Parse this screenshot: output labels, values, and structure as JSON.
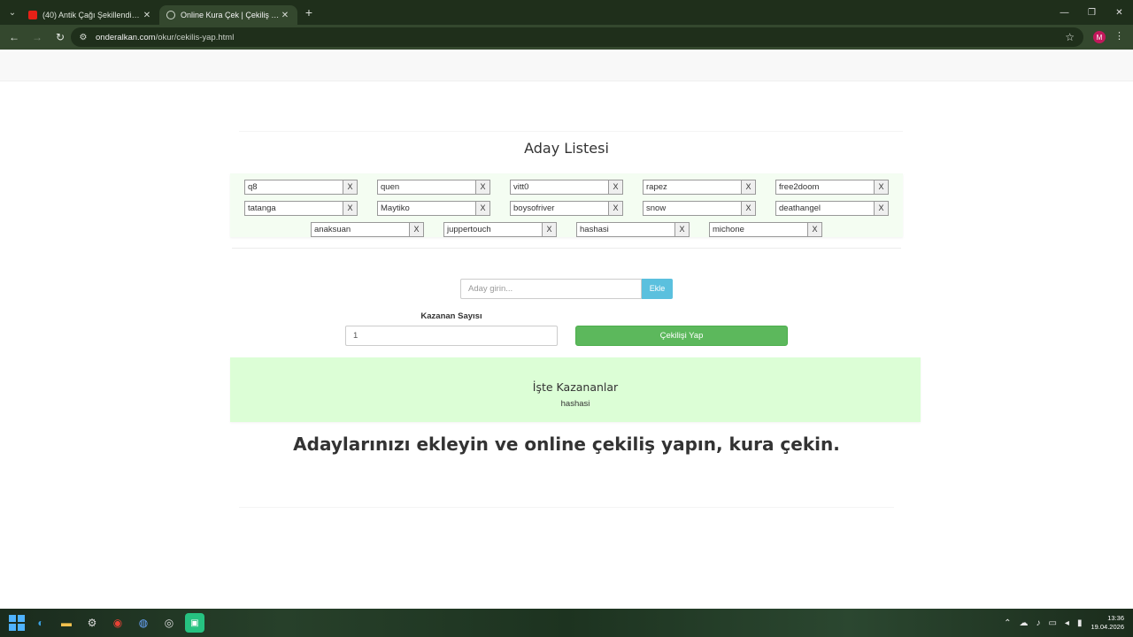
{
  "browser": {
    "tabs": [
      {
        "title": "(40) Antik Çağı Şekillendiren Bü",
        "favicon": "youtube-icon",
        "active": false
      },
      {
        "title": "Online Kura Çek | Çekiliş Yap",
        "favicon": "globe-icon",
        "active": true
      }
    ],
    "url_host": "onderalkan.com",
    "url_path": "/okur/cekilis-yap.html",
    "profile_initial": "M"
  },
  "page": {
    "list_title": "Aday Listesi",
    "delete_label": "X",
    "candidates_rows": [
      [
        "q8",
        "quen",
        "vitt0",
        "rapez",
        "free2doom"
      ],
      [
        "tatanga",
        "Maytiko",
        "boysofriver",
        "snow",
        "deathangel"
      ],
      [
        "anaksuan",
        "juppertouch",
        "hashasi",
        "michone"
      ]
    ],
    "add_placeholder": "Aday girin...",
    "add_button": "Ekle",
    "count_label": "Kazanan Sayısı",
    "count_value": "1",
    "draw_button": "Çekilişi Yap",
    "winners_title": "İşte Kazananlar",
    "winner": "hashasi",
    "headline": "Adaylarınızı ekleyin ve online çekiliş yapın, kura çekin."
  },
  "taskbar": {
    "time": "13:36",
    "date": "19.04.2026"
  },
  "colors": {
    "add_button": "#5bc0de",
    "draw_button": "#5cb85c",
    "winners_bg": "#dcfed6",
    "candidates_bg": "#f4fdf2"
  }
}
